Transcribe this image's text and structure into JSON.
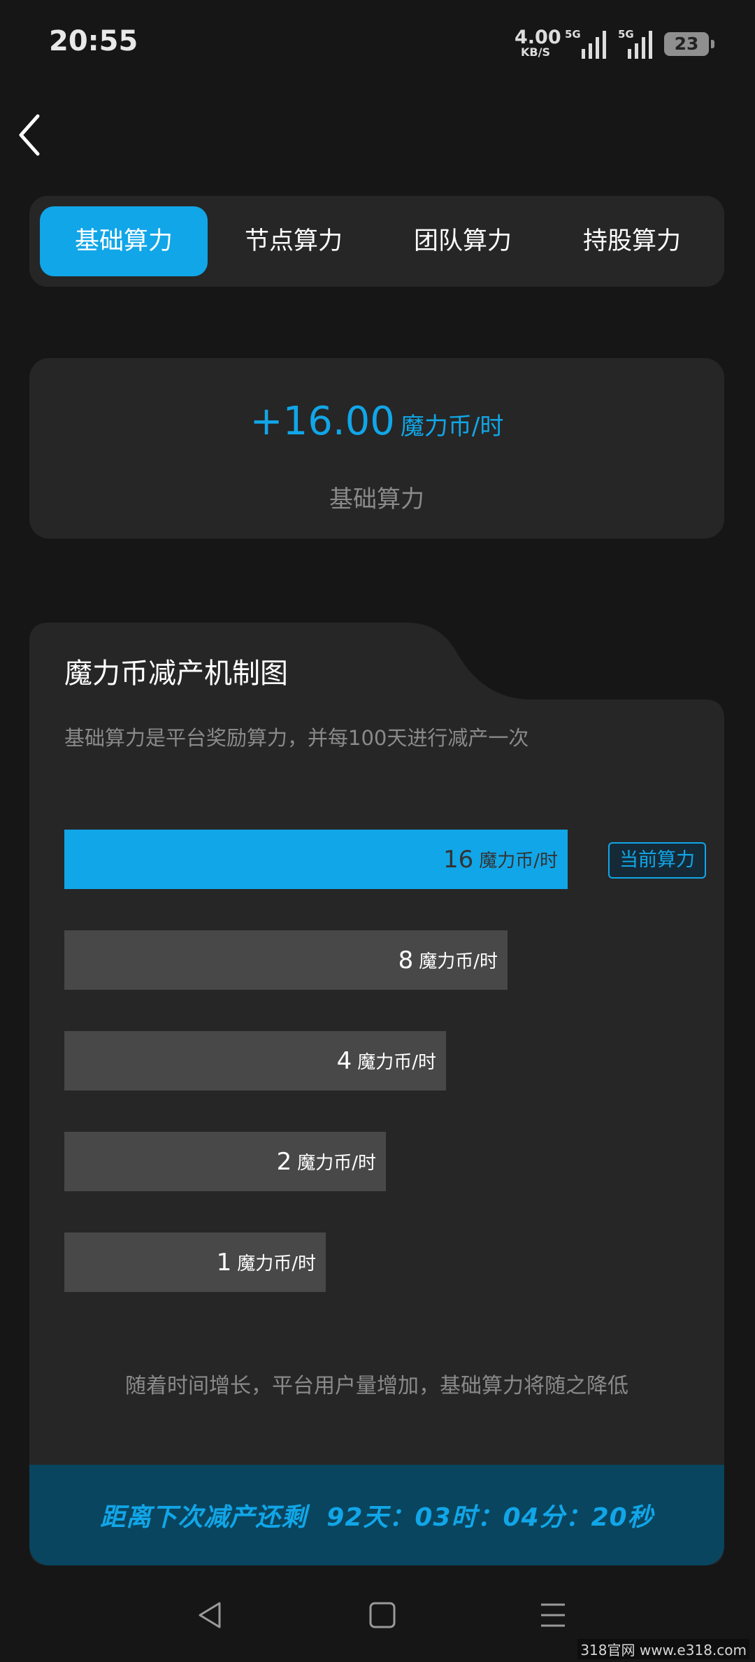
{
  "status_bar": {
    "time": "20:55",
    "net_speed_value": "4.00",
    "net_speed_unit": "KB/S",
    "signal1_label": "5G",
    "signal2_label": "5G",
    "battery": "23"
  },
  "tabs": [
    {
      "label": "基础算力",
      "active": true
    },
    {
      "label": "节点算力",
      "active": false
    },
    {
      "label": "团队算力",
      "active": false
    },
    {
      "label": "持股算力",
      "active": false
    }
  ],
  "rate_card": {
    "value": "+16.00",
    "unit": "魔力币/时",
    "label": "基础算力"
  },
  "panel": {
    "title": "魔力币减产机制图",
    "description": "基础算力是平台奖励算力，并每100天进行减产一次",
    "current_badge": "当前算力",
    "note": "随着时间增长，平台用户量增加，基础算力将随之降低",
    "countdown": {
      "prefix": "距离下次减产还剩",
      "time": "92天：03时：04分：20秒"
    }
  },
  "chart_data": {
    "type": "bar",
    "orientation": "horizontal",
    "categories": [
      "16 魔力币/时",
      "8 魔力币/时",
      "4 魔力币/时",
      "2 魔力币/时",
      "1 魔力币/时"
    ],
    "values": [
      16,
      8,
      4,
      2,
      1
    ],
    "value_labels": [
      "16",
      "8",
      "4",
      "2",
      "1"
    ],
    "unit": "魔力币/时",
    "highlighted_index": 0,
    "colors": {
      "current": "#11a6e8",
      "other": "#484848"
    }
  },
  "colors": {
    "accent": "#11a6e8",
    "background": "#161616",
    "card": "#262626",
    "countdown_bg": "#09455f"
  },
  "nav": [
    "back-triangle-icon",
    "home-square-icon",
    "menu-lines-icon"
  ],
  "watermark": "318官网 www.e318.com"
}
